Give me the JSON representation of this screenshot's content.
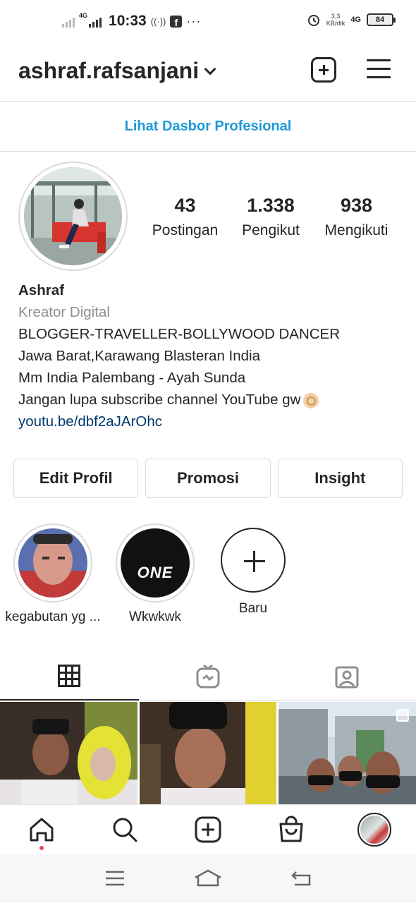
{
  "status_bar": {
    "network_badge": "4G",
    "time": "10:33",
    "hotspot_icon": "wifi-hotspot-icon",
    "speed_value": "3,3",
    "speed_unit": "KB/dtk",
    "network_right": "4G",
    "battery": "84"
  },
  "header": {
    "username": "ashraf.rafsanjani",
    "add_icon": "add-square-icon",
    "menu_icon": "hamburger-icon"
  },
  "professional_dashboard": "Lihat Dasbor Profesional",
  "stats": {
    "posts_count": "43",
    "posts_label": "Postingan",
    "followers_count": "1.338",
    "followers_label": "Pengikut",
    "following_count": "938",
    "following_label": "Mengikuti"
  },
  "bio": {
    "name": "Ashraf",
    "category": "Kreator Digital",
    "line1": "BLOGGER-TRAVELLER-BOLLYWOOD DANCER",
    "line2": "Jawa Barat,Karawang Blasteran India",
    "line3": "Mm India Palembang - Ayah Sunda",
    "line4": "Jangan lupa subscribe channel YouTube gw",
    "link": "youtu.be/dbf2aJArOhc"
  },
  "buttons": {
    "edit_profile": "Edit Profil",
    "promote": "Promosi",
    "insights": "Insight"
  },
  "highlights": [
    {
      "label": "kegabutan yg ..."
    },
    {
      "label": "Wkwkwk",
      "cover_text": "ONE"
    },
    {
      "label": "Baru"
    }
  ],
  "tabs": [
    "grid-icon",
    "igtv-icon",
    "tagged-icon"
  ],
  "bottom_nav": [
    "home-icon",
    "search-icon",
    "add-icon",
    "shop-icon",
    "profile-avatar"
  ],
  "colors": {
    "link_blue": "#1f9ad6",
    "bio_link": "#00376b",
    "text": "#262626",
    "secondary": "#8e8e8e",
    "border": "#dbdbdb",
    "notification": "#ed4956"
  }
}
